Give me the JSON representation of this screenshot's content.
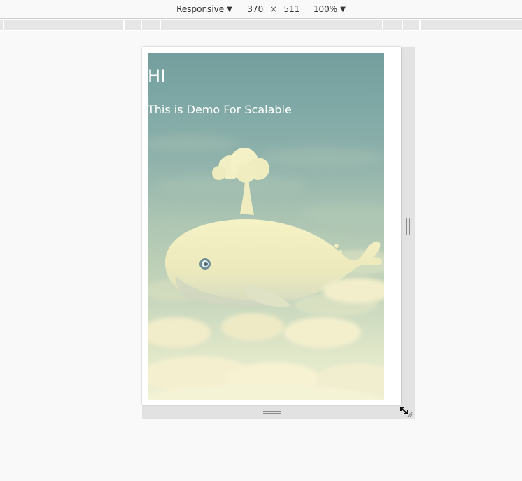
{
  "toolbar": {
    "device_label": "Responsive",
    "width_value": "370",
    "times_symbol": "×",
    "height_value": "511",
    "zoom_label": "100%",
    "caret_icon": "▼"
  },
  "page": {
    "heading": "HI",
    "subheading": "This is Demo For Scalable"
  },
  "colors": {
    "sky_top": "#739e9d",
    "sky_bottom": "#eef0d3",
    "whale": "#f1efc0",
    "cloud": "#f6f1cf"
  },
  "icons": {
    "device_caret": "chevron-down-icon",
    "zoom_caret": "chevron-down-icon",
    "right_handle": "resize-horizontal-icon",
    "bottom_handle": "resize-vertical-icon",
    "corner_handle": "resize-diagonal-icon"
  }
}
